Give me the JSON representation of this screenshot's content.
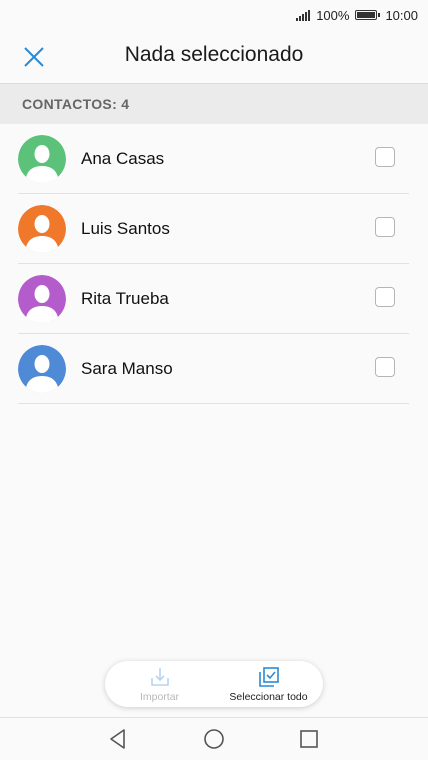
{
  "status_bar": {
    "battery": "100%",
    "time": "10:00",
    "icons": [
      "signal-icon",
      "battery-icon"
    ]
  },
  "header": {
    "title": "Nada seleccionado",
    "close_icon": "close-icon",
    "accent": "#2a8ad6"
  },
  "section": {
    "label": "CONTACTOS: 4"
  },
  "contacts": [
    {
      "name": "Ana Casas",
      "color": "#5cc27a",
      "checked": false
    },
    {
      "name": "Luis Santos",
      "color": "#f0782b",
      "checked": false
    },
    {
      "name": "Rita Trueba",
      "color": "#b55ccd",
      "checked": false
    },
    {
      "name": "Sara Manso",
      "color": "#4f8ad6",
      "checked": false
    }
  ],
  "toolbar": {
    "import_label": "Importar",
    "import_enabled": false,
    "select_all_label": "Seleccionar todo",
    "select_all_enabled": true
  },
  "nav": {
    "icons": [
      "back-icon",
      "home-icon",
      "recents-icon"
    ]
  }
}
